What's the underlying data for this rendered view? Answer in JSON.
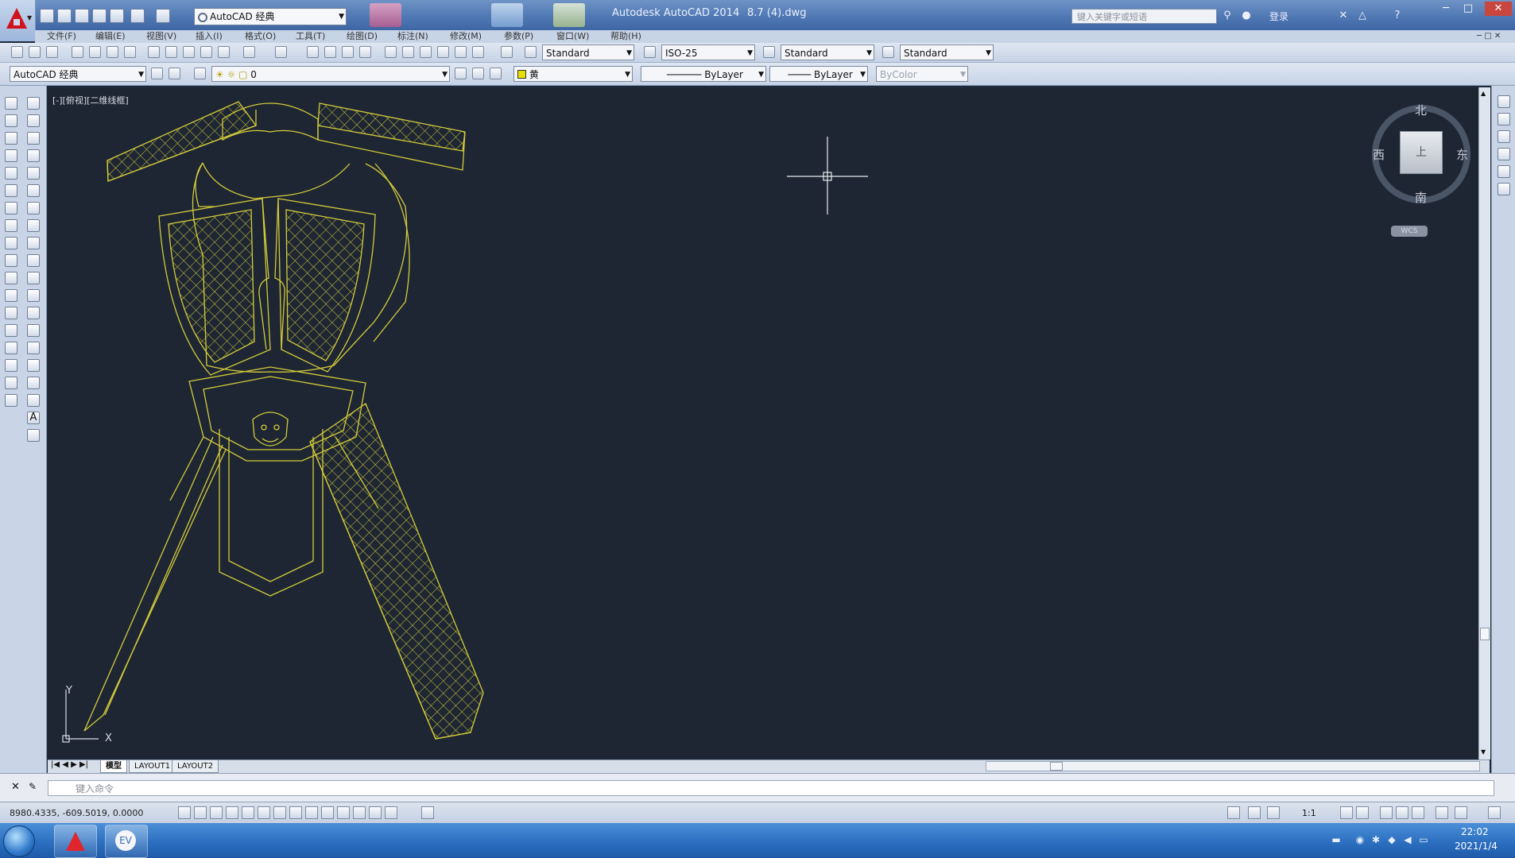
{
  "window": {
    "title": "Autodesk AutoCAD 2014",
    "file_name": "8.7 (4).dwg",
    "search_placeholder": "键入关键字或短语",
    "signin_label": "登录"
  },
  "quick_access": {
    "workspace": "AutoCAD 经典"
  },
  "menu": {
    "items": [
      "文件(F)",
      "编辑(E)",
      "视图(V)",
      "插入(I)",
      "格式(O)",
      "工具(T)",
      "绘图(D)",
      "标注(N)",
      "修改(M)",
      "参数(P)",
      "窗口(W)",
      "帮助(H)"
    ]
  },
  "toolbar1": {
    "text_style": "Standard",
    "dim_style": "ISO-25",
    "table_style": "Standard",
    "mleader_style": "Standard"
  },
  "toolbar2": {
    "workspace": "AutoCAD 经典",
    "layer": "0",
    "color": "黄",
    "linetype": "ByLayer",
    "lineweight": "ByLayer",
    "plotstyle": "ByColor"
  },
  "viewport": {
    "label": "[-][俯视][二维线框]"
  },
  "viewcube": {
    "north": "北",
    "south": "南",
    "east": "东",
    "west": "西",
    "face": "上",
    "wcs": "WCS"
  },
  "ucs": {
    "x": "X",
    "y": "Y"
  },
  "layout_tabs": [
    "模型",
    "LAYOUT1",
    "LAYOUT2"
  ],
  "command_line": {
    "placeholder": "键入命令"
  },
  "status": {
    "coords": "8980.4335, -609.5019, 0.0000",
    "annotation_scale": "1:1"
  },
  "taskbar": {
    "time": "22:02",
    "date": "2021/1/4"
  },
  "colors": {
    "drawing_lines": "#d4cc3a",
    "canvas_bg": "#1e2633",
    "crosshair": "#e8ecf0"
  }
}
